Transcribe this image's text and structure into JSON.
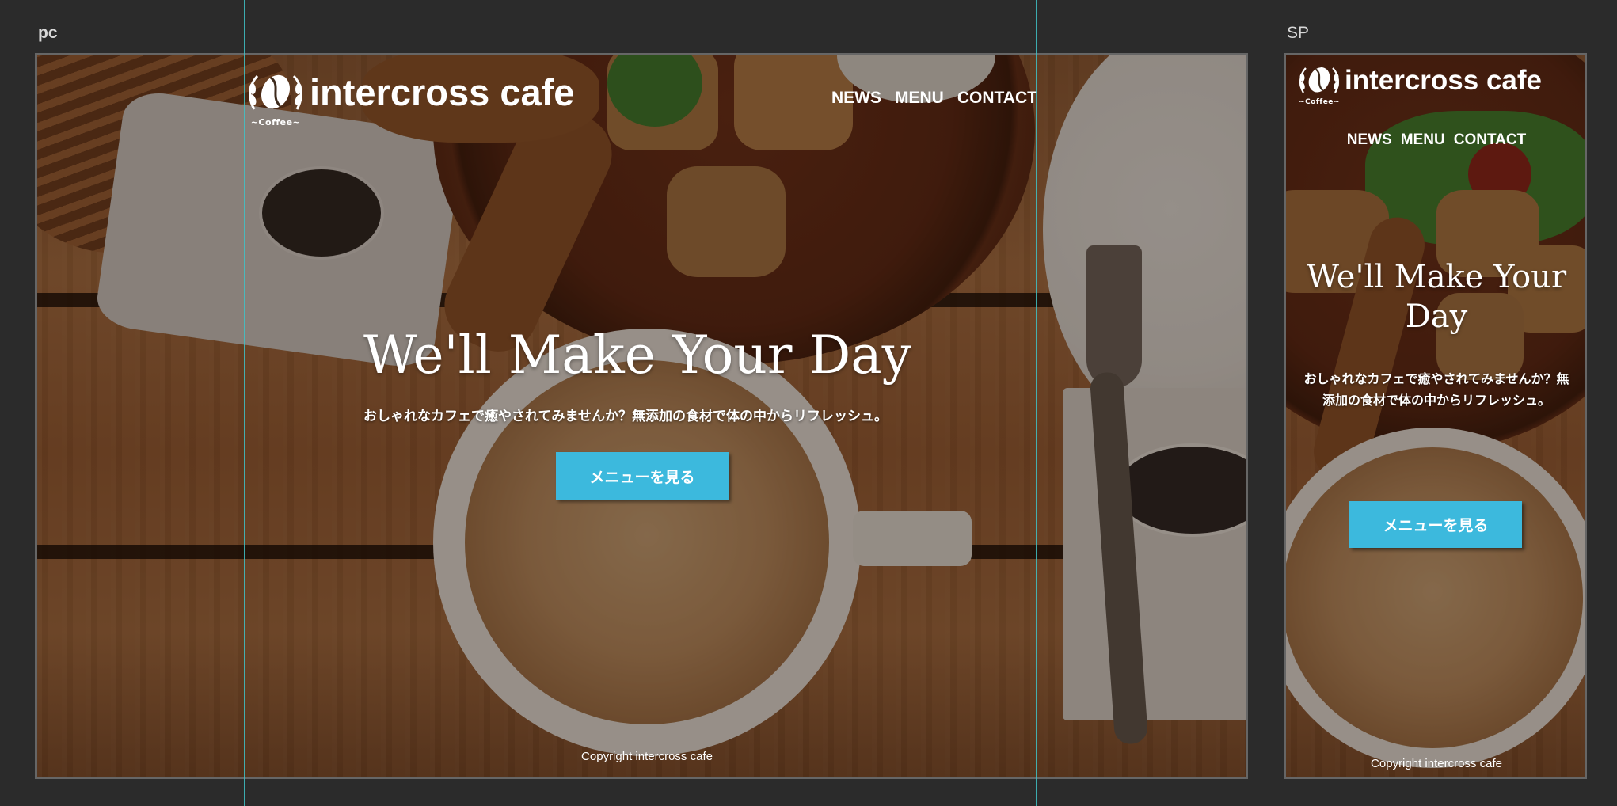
{
  "artboards": {
    "pc_label": "pc",
    "sp_label": "SP"
  },
  "brand": {
    "name": "intercross cafe",
    "sub": "~Coffee~",
    "icon": "coffee-bean-icon"
  },
  "nav": {
    "items": [
      "NEWS",
      "MENU",
      "CONTACT"
    ]
  },
  "hero": {
    "headline": "We'll Make Your Day",
    "lead": "おしゃれなカフェで癒やされてみませんか？無添加の食材で体の中からリフレッシュ。",
    "cta_label": "メニューを見る"
  },
  "footer": {
    "copyright": "Copyright intercross cafe"
  },
  "colors": {
    "canvas": "#2b2b2b",
    "guide": "#3fc3c8",
    "cta": "#3cb9dd",
    "text": "#ffffff"
  }
}
